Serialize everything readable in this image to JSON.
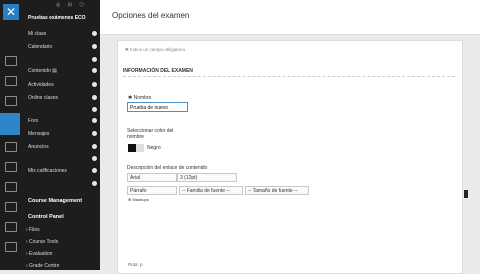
{
  "rail": {
    "close_label": "✕"
  },
  "sidebar": {
    "course_title": "Pruebas exámenes ECO",
    "top_icons": "◎ ⊟ ⬡",
    "items": [
      {
        "label": "Mi clase"
      },
      {
        "label": "Calendario"
      },
      {
        "label": "Contenido ▤"
      },
      {
        "label": "Actividades"
      },
      {
        "label": "Online clases"
      },
      {
        "label": "Foro"
      },
      {
        "label": "Mensajes"
      },
      {
        "label": "Anuncios"
      },
      {
        "label": "Mis calificaciones"
      }
    ],
    "course_management": "Course Management",
    "control_panel": "Control Panel",
    "cp_items": [
      {
        "label": "› Files"
      },
      {
        "label": "› Course Tools"
      },
      {
        "label": "› Evaluation"
      },
      {
        "label": "› Grade Centre"
      }
    ]
  },
  "header": {
    "title": "Opciones del examen"
  },
  "form": {
    "required_note": "✱ Indica un campo obligatorio.",
    "section": "INFORMACIÓN DEL EXAMEN",
    "name_label": "✱  Nombre",
    "name_value": "Prueba de nuevo",
    "color_label": "Seleccionar color del nombre",
    "color_name": "Negro",
    "desc_label": "Descripción del enlace de contenido",
    "font": "Arial",
    "size": "3 (12pt)",
    "paragraph": "Párrafo",
    "font_family": "-- Familia de fuente --",
    "font_size": "-- Tamaño de fuente --",
    "mashups": "⊕ Mashups",
    "path": "Ruta: p"
  }
}
